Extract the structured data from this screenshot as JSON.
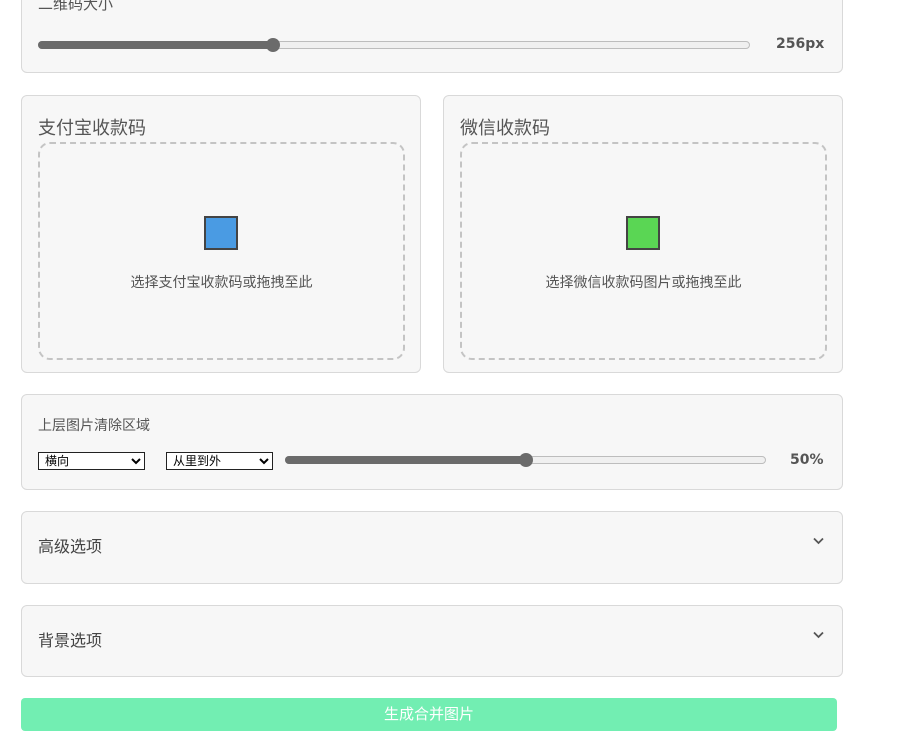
{
  "size_section": {
    "label": "二维码大小",
    "value_text": "256px",
    "slider_fraction": 0.33
  },
  "alipay": {
    "title": "支付宝收款码",
    "prompt": "选择支付宝收款码或拖拽至此",
    "icon_color": "#4a9be3",
    "icon": "blue-square-icon"
  },
  "wechat": {
    "title": "微信收款码",
    "prompt": "选择微信收款码图片或拖拽至此",
    "icon_color": "#5ad654",
    "icon": "green-square-icon"
  },
  "clear_area": {
    "label": "上层图片清除区域",
    "direction_selected": "横向",
    "order_selected": "从里到外",
    "value_text": "50%",
    "slider_fraction": 0.5
  },
  "advanced": {
    "title": "高级选项",
    "icon": "chevron-down-icon"
  },
  "background": {
    "title": "背景选项",
    "icon": "chevron-down-icon"
  },
  "generate_button": {
    "label": "生成合并图片",
    "color": "#72eeb2"
  }
}
